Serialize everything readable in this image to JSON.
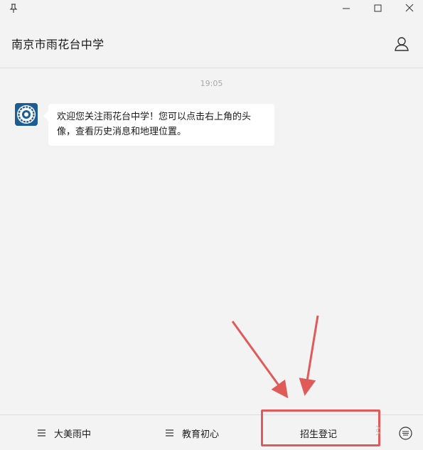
{
  "window": {
    "icons": [
      "pin-icon",
      "minimize-icon",
      "maximize-icon",
      "close-icon"
    ]
  },
  "header": {
    "title": "南京市雨花台中学",
    "profile_icon": "person-icon"
  },
  "chat": {
    "timestamp": "19:05",
    "messages": [
      {
        "sender_avatar": "school-logo",
        "text": "欢迎您关注雨花台中学！您可以点击右上角的头像，查看历史消息和地理位置。"
      }
    ]
  },
  "menu": {
    "items": [
      {
        "label": "大美雨中",
        "icon": "menu-list-icon"
      },
      {
        "label": "教育初心",
        "icon": "menu-list-icon"
      },
      {
        "label": "招生登记"
      }
    ],
    "keyboard_icon": "keyboard-icon"
  },
  "annotation": {
    "color": "#e05a5a"
  }
}
